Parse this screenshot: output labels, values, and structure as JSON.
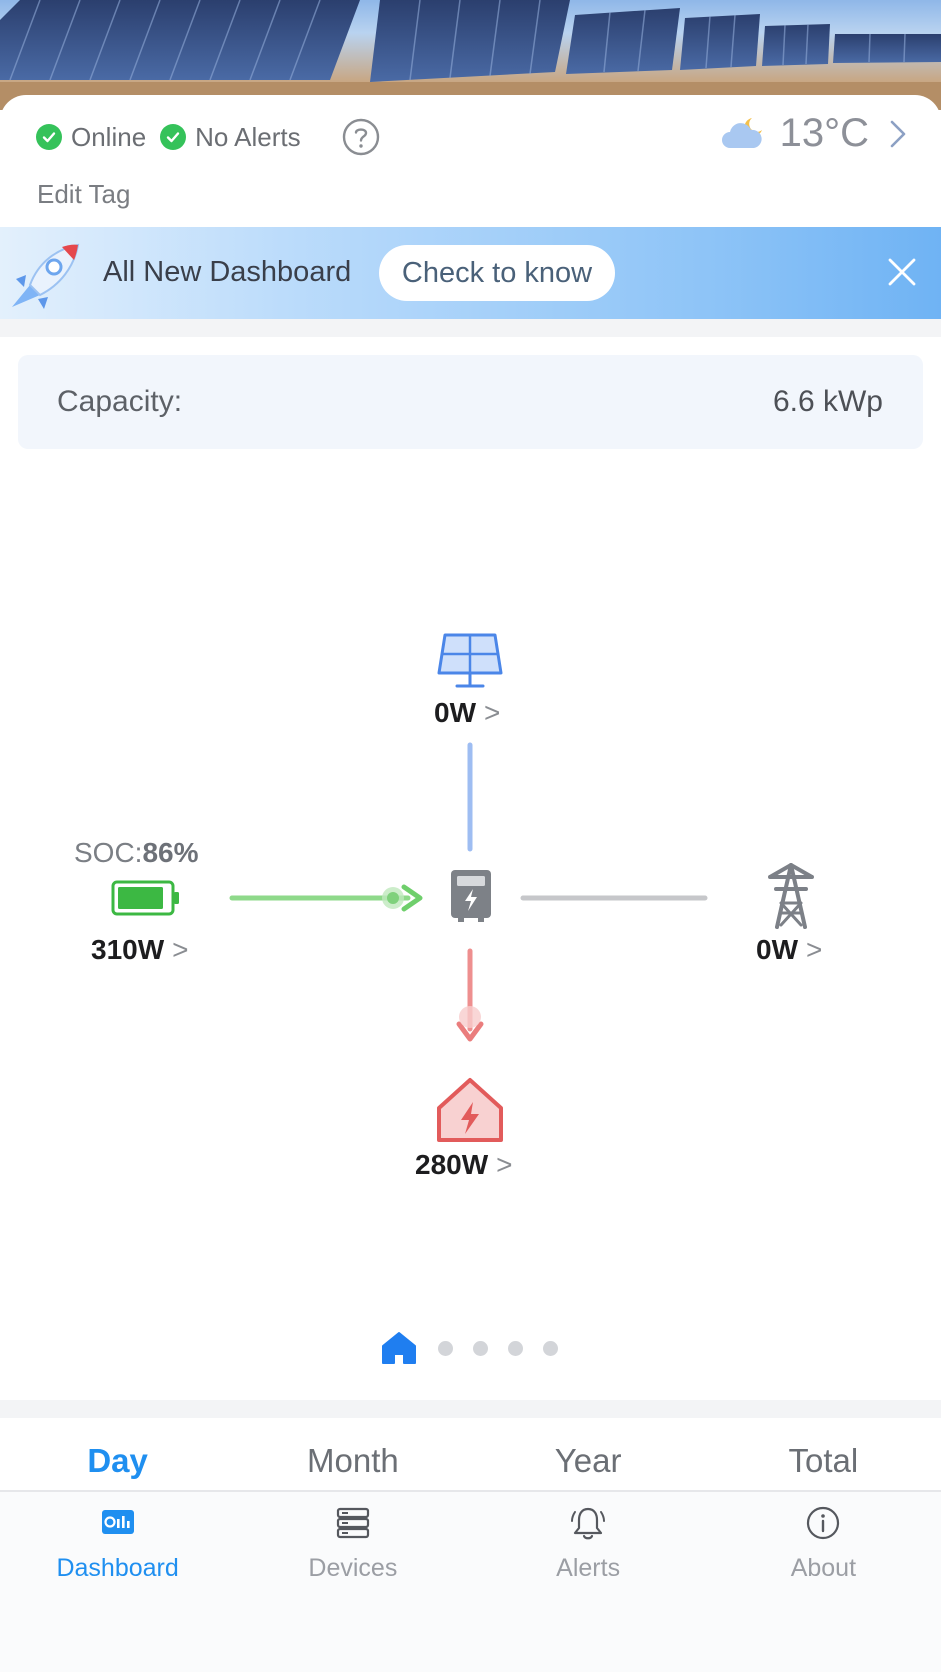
{
  "status": {
    "online_label": "Online",
    "alerts_label": "No Alerts",
    "edit_tag_label": "Edit Tag",
    "temperature": "13°C"
  },
  "banner": {
    "title": "All New Dashboard",
    "button_label": "Check to know"
  },
  "capacity": {
    "label": "Capacity:",
    "value": "6.6 kWp"
  },
  "flow": {
    "solar_power": "0W",
    "battery_soc_label": "SOC:",
    "battery_soc_value": "86%",
    "battery_power": "310W",
    "grid_power": "0W",
    "home_power": "280W",
    "arrow_glyph": ">"
  },
  "pager": {
    "active_index": 0,
    "count": 5
  },
  "period_tabs": [
    "Day",
    "Month",
    "Year",
    "Total"
  ],
  "bottom_nav": [
    {
      "label": "Dashboard",
      "icon": "dashboard-icon"
    },
    {
      "label": "Devices",
      "icon": "devices-icon"
    },
    {
      "label": "Alerts",
      "icon": "bell-icon"
    },
    {
      "label": "About",
      "icon": "info-icon"
    }
  ],
  "colors": {
    "accent": "#1f8ff0",
    "online_green": "#35c25a",
    "battery_flow": "#8ed98a",
    "home_flow": "#ee8f8f",
    "solar_flow": "#9ebdf2",
    "grid_flow": "#c6c7ca"
  }
}
